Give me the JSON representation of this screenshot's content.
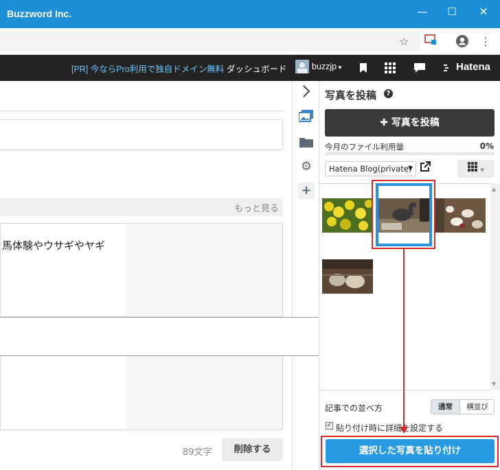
{
  "window": {
    "title": "Buzzword Inc.",
    "controls": [
      "—",
      "☐",
      "✕"
    ]
  },
  "toolbar": {
    "icons": [
      "star-icon",
      "cast-icon",
      "profile-icon",
      "menu-icon"
    ]
  },
  "hatena_bar": {
    "promo": "[PR] 今ならPro利用で独自ドメイン無料",
    "dashboard": "ダッシュボード",
    "user": "buzzjp",
    "brand": "Hatena"
  },
  "editor": {
    "more_link": "もっと見る",
    "body_text": "馬体験やウサギやヤギ",
    "char_count": "89文字",
    "delete_label": "削除する"
  },
  "photo_panel": {
    "title": "写真を投稿",
    "post_button": "写真を投稿",
    "usage_label": "今月のファイル利用量",
    "usage_percent": "0%",
    "usage_fraction": 0,
    "blog_select": "Hatena Blog(private)",
    "sort_label": "記事での並べ方",
    "sort_options": [
      "通常",
      "横並び"
    ],
    "sort_selected": "通常",
    "detail_checkbox_label": "貼り付け時に詳細を設定する",
    "detail_checked": true,
    "paste_button": "選択した写真を貼り付け"
  },
  "colors": {
    "titlebar": "#1c8fd6",
    "hatena_bar": "#232323",
    "promo_link": "#68c7ff",
    "post_button": "#3a3a3a",
    "paste_button": "#279ae3",
    "selection": "#2b8fdc",
    "annotation": "#d9262b"
  }
}
